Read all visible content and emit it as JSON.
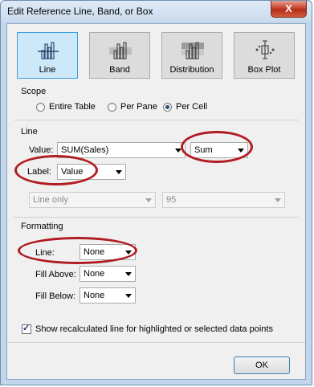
{
  "window": {
    "title": "Edit Reference Line, Band, or Box",
    "close_glyph": "X"
  },
  "types": [
    {
      "label": "Line",
      "icon": "line-chart-icon",
      "selected": true
    },
    {
      "label": "Band",
      "icon": "band-chart-icon",
      "selected": false
    },
    {
      "label": "Distribution",
      "icon": "distribution-chart-icon",
      "selected": false
    },
    {
      "label": "Box Plot",
      "icon": "box-plot-icon",
      "selected": false
    }
  ],
  "scope": {
    "title": "Scope",
    "options": [
      {
        "label": "Entire Table",
        "checked": false
      },
      {
        "label": "Per Pane",
        "checked": false
      },
      {
        "label": "Per Cell",
        "checked": true
      }
    ]
  },
  "line": {
    "title": "Line",
    "value_label": "Value:",
    "value_field": "SUM(Sales)",
    "aggregation": "Sum",
    "label_label": "Label:",
    "label_value": "Value",
    "disabled_type": "Line only",
    "disabled_percent": "95"
  },
  "formatting": {
    "title": "Formatting",
    "line_label": "Line:",
    "line_value": "None",
    "fill_above_label": "Fill Above:",
    "fill_above_value": "None",
    "fill_below_label": "Fill Below:",
    "fill_below_value": "None"
  },
  "show_recalculated": {
    "label": "Show recalculated line for highlighted or selected data points",
    "checked": true
  },
  "ok_label": "OK",
  "annotation_color": "#b01d22"
}
